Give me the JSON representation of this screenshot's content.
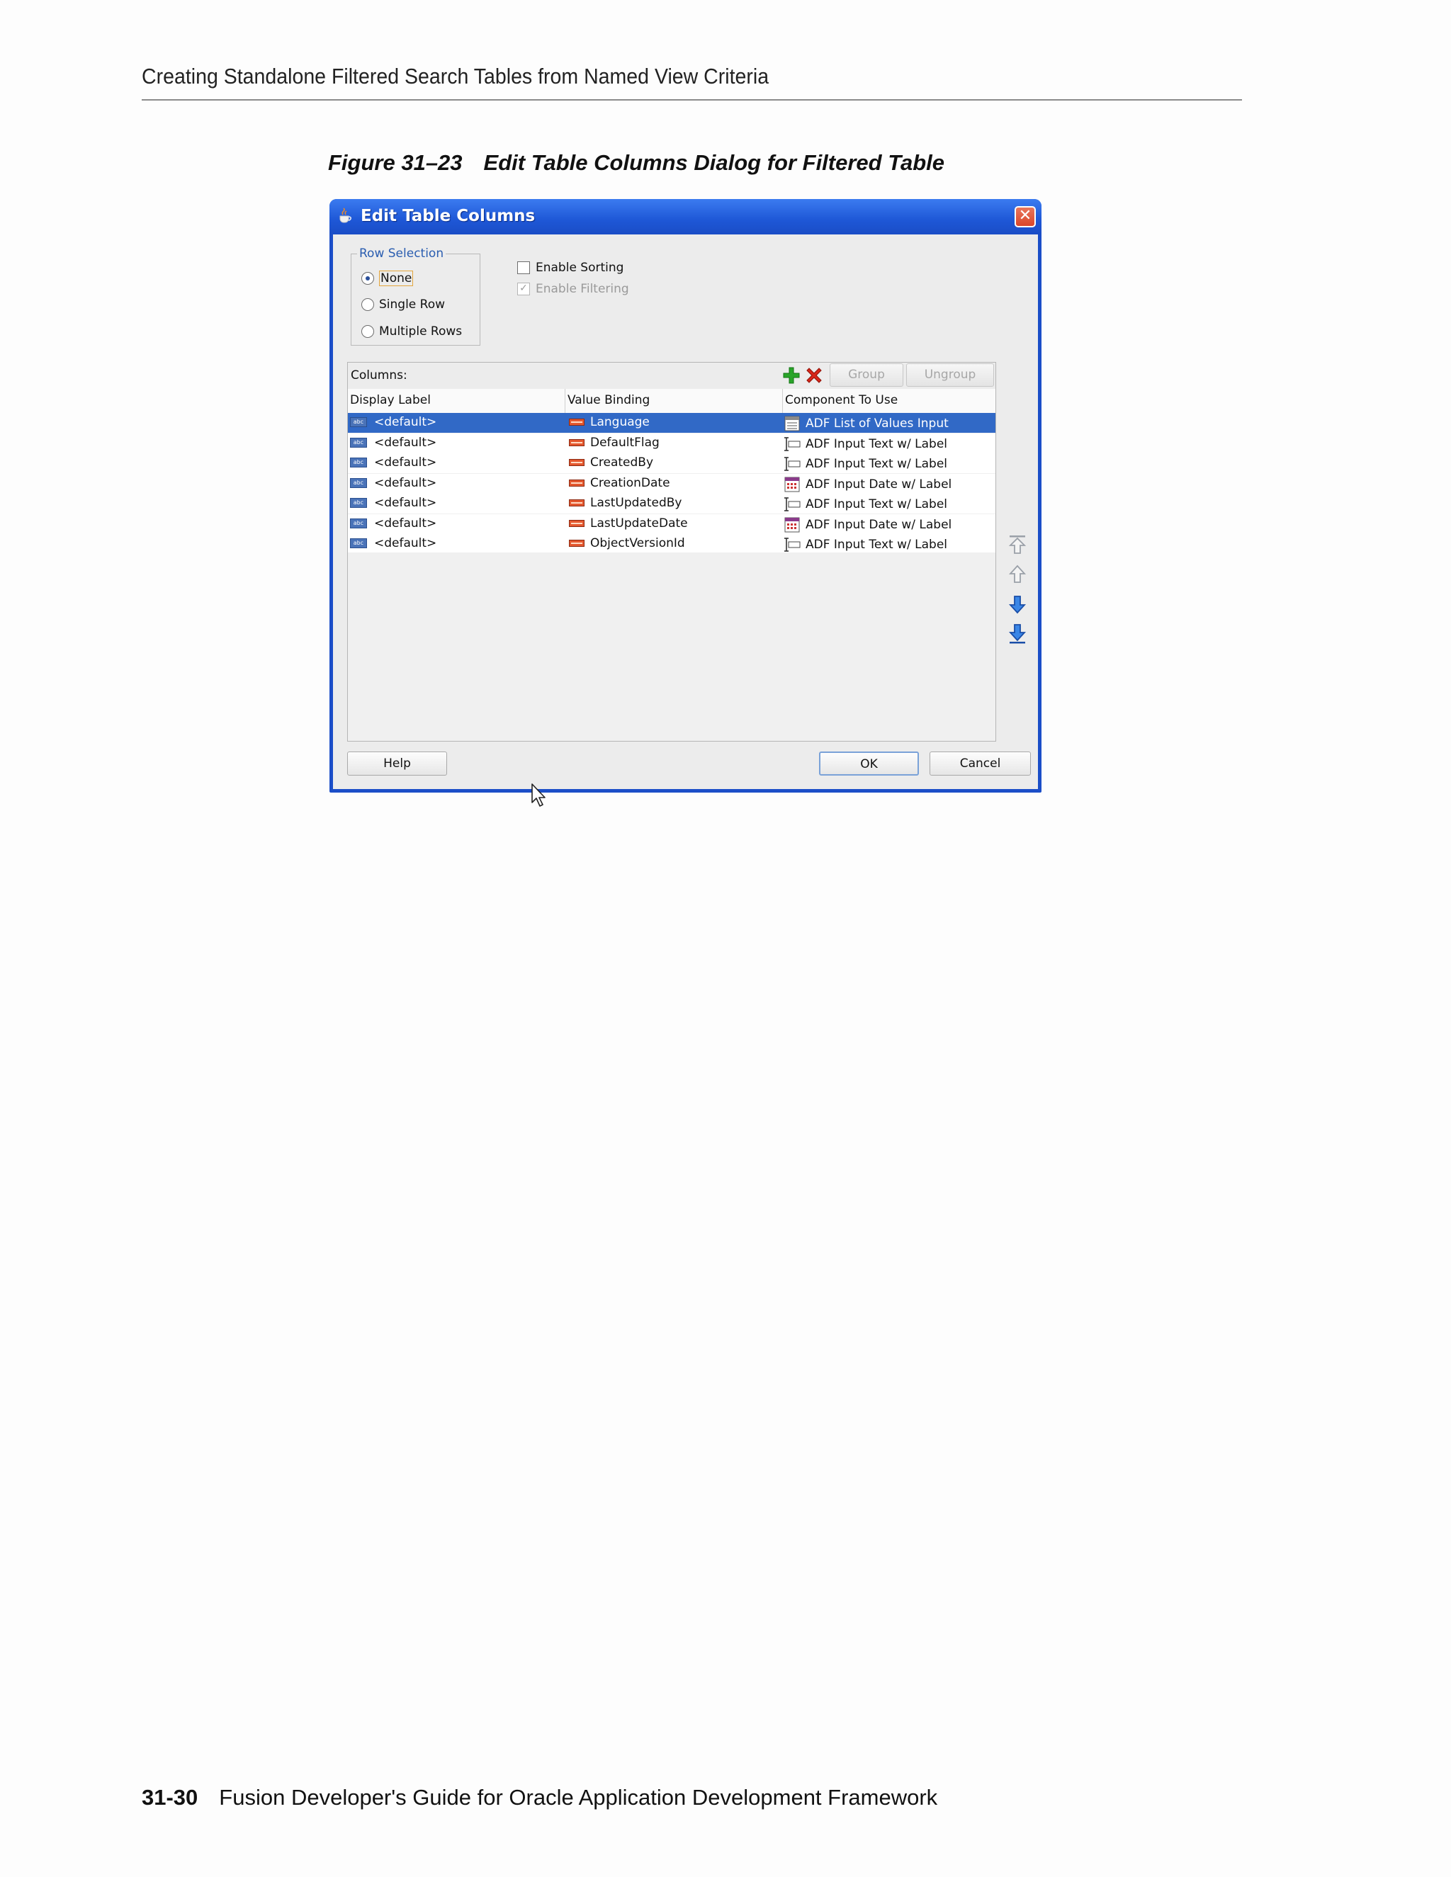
{
  "page": {
    "header": "Creating Standalone Filtered Search Tables from Named View Criteria",
    "figure_label": "Figure 31–23",
    "figure_title": "Edit Table Columns Dialog for Filtered Table",
    "footer_page_number": "31-30",
    "footer_title": "Fusion Developer's Guide for Oracle Application Development Framework"
  },
  "dialog": {
    "title": "Edit Table Columns",
    "close_glyph": "✕",
    "row_selection": {
      "legend": "Row Selection",
      "options": [
        "None",
        "Single Row",
        "Multiple Rows"
      ],
      "selected": "None"
    },
    "enable_sorting": {
      "label": "Enable Sorting",
      "checked": false
    },
    "enable_filtering": {
      "label": "Enable Filtering",
      "checked": true,
      "disabled": true
    },
    "columns_label": "Columns:",
    "group_button": "Group",
    "ungroup_button": "Ungroup",
    "headers": [
      "Display Label",
      "Value Binding",
      "Component To Use"
    ],
    "rows": [
      {
        "label": "<default>",
        "binding": "Language",
        "component": "ADF List of Values Input",
        "component_icon": "list-of-values-icon"
      },
      {
        "label": "<default>",
        "binding": "DefaultFlag",
        "component": "ADF Input Text w/ Label",
        "component_icon": "input-text-icon"
      },
      {
        "label": "<default>",
        "binding": "CreatedBy",
        "component": "ADF Input Text w/ Label",
        "component_icon": "input-text-icon"
      },
      {
        "label": "<default>",
        "binding": "CreationDate",
        "component": "ADF Input Date w/ Label",
        "component_icon": "input-date-icon"
      },
      {
        "label": "<default>",
        "binding": "LastUpdatedBy",
        "component": "ADF Input Text w/ Label",
        "component_icon": "input-text-icon"
      },
      {
        "label": "<default>",
        "binding": "LastUpdateDate",
        "component": "ADF Input Date w/ Label",
        "component_icon": "input-date-icon"
      },
      {
        "label": "<default>",
        "binding": "ObjectVersionId",
        "component": "ADF Input Text w/ Label",
        "component_icon": "input-text-icon"
      }
    ],
    "selected_row": 0,
    "help_button": "Help",
    "ok_button": "OK",
    "cancel_button": "Cancel"
  },
  "colors": {
    "title_bar": "#1e57d6",
    "selection": "#3169c6",
    "add_icon": "#2aa52a",
    "delete_icon": "#d8261a"
  }
}
